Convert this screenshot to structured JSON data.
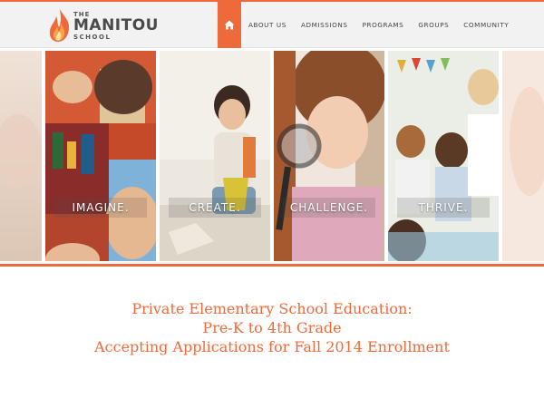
{
  "logo": {
    "line1": "THE",
    "line2": "MANITOU",
    "line3": "SCHOOL"
  },
  "nav": {
    "home_icon": "home-icon",
    "items": [
      "ABOUT US",
      "ADMISSIONS",
      "PROGRAMS",
      "GROUPS",
      "COMMUNITY"
    ]
  },
  "hero": {
    "panels": [
      "IMAGINE.",
      "CREATE.",
      "CHALLENGE.",
      "THRIVE."
    ]
  },
  "intro": {
    "line1": "Private Elementary School Education:",
    "line2": "Pre-K to 4th Grade",
    "line3": "Accepting Applications for Fall 2014 Enrollment"
  },
  "colors": {
    "accent": "#ee6a3a",
    "header_bg": "#f2f2f2",
    "nav_text": "#444444"
  }
}
